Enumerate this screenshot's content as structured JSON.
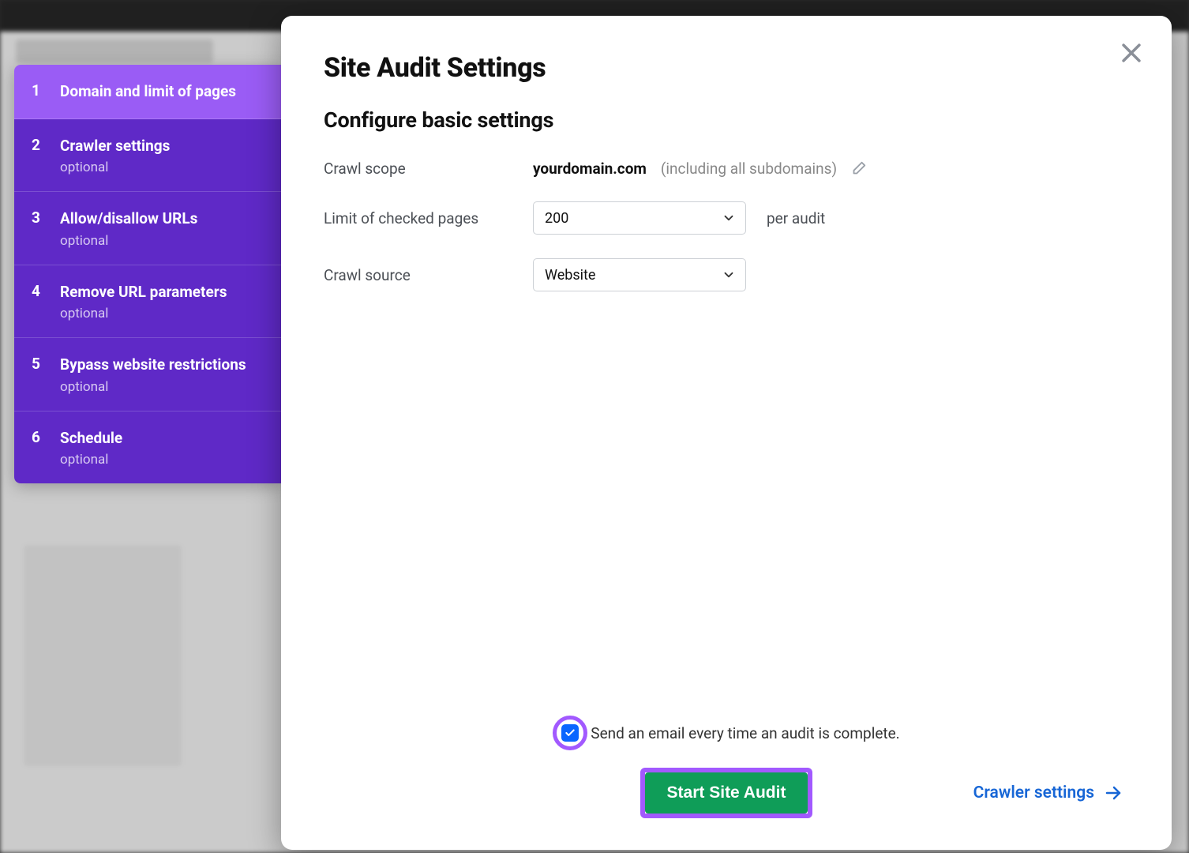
{
  "sidebar": {
    "steps": [
      {
        "num": "1",
        "label": "Domain and limit of pages",
        "tag": ""
      },
      {
        "num": "2",
        "label": "Crawler settings",
        "tag": "optional"
      },
      {
        "num": "3",
        "label": "Allow/disallow URLs",
        "tag": "optional"
      },
      {
        "num": "4",
        "label": "Remove URL parameters",
        "tag": "optional"
      },
      {
        "num": "5",
        "label": "Bypass website restrictions",
        "tag": "optional"
      },
      {
        "num": "6",
        "label": "Schedule",
        "tag": "optional"
      }
    ]
  },
  "modal": {
    "title": "Site Audit Settings",
    "subtitle": "Configure basic settings",
    "fields": {
      "crawl_scope_label": "Crawl scope",
      "crawl_scope_domain": "yourdomain.com",
      "crawl_scope_extra": "(including all subdomains)",
      "limit_label": "Limit of checked pages",
      "limit_value": "200",
      "limit_unit": "per audit",
      "crawl_source_label": "Crawl source",
      "crawl_source_value": "Website"
    },
    "footer": {
      "checkbox_label": "Send an email every time an audit is complete.",
      "start_button": "Start Site Audit",
      "next_link": "Crawler settings"
    }
  }
}
